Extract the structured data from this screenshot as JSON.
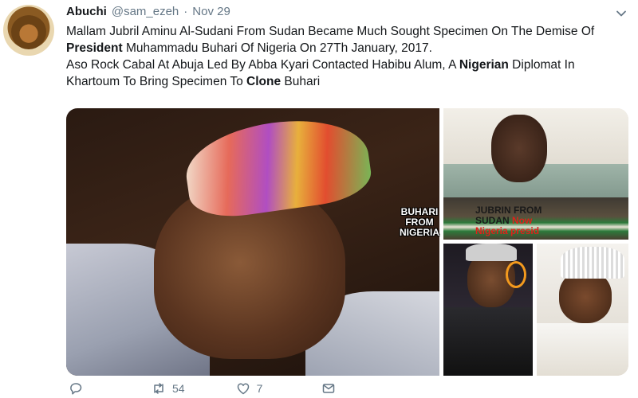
{
  "tweet": {
    "author_name": "Abuchi",
    "handle": "@sam_ezeh",
    "separator": "·",
    "time": "Nov 29",
    "paragraph1": {
      "t1": "Mallam Jubril Aminu Al-Sudani From Sudan Became Much Sought Specimen On The Demise Of ",
      "b1": "President",
      "t2": " Muhammadu Buhari Of Nigeria On 27Th January, 2017."
    },
    "paragraph2": {
      "t1": "Aso Rock Cabal At Abuja Led By Abba Kyari Contacted Habibu Alum, A ",
      "b1": "Nigerian",
      "t2": " Diplomat In Khartoum To Bring Specimen To ",
      "b2": "Clone",
      "t3": " Buhari"
    }
  },
  "media": {
    "caption_left": [
      "BUHARI",
      "FROM",
      "NIGERIA"
    ],
    "caption_right_line1": "JUBRIN FROM",
    "caption_right_line2a": "SUDAN ",
    "caption_right_line2b": "Now",
    "caption_right_line3": "Nigeria presid"
  },
  "actions": {
    "reply_icon": "reply-icon",
    "retweet_icon": "retweet-icon",
    "retweet_count": "54",
    "like_icon": "heart-icon",
    "like_count": "7",
    "dm_icon": "envelope-icon"
  },
  "colors": {
    "text": "#14171a",
    "muted": "#657786",
    "caption_red": "#e0201b"
  }
}
